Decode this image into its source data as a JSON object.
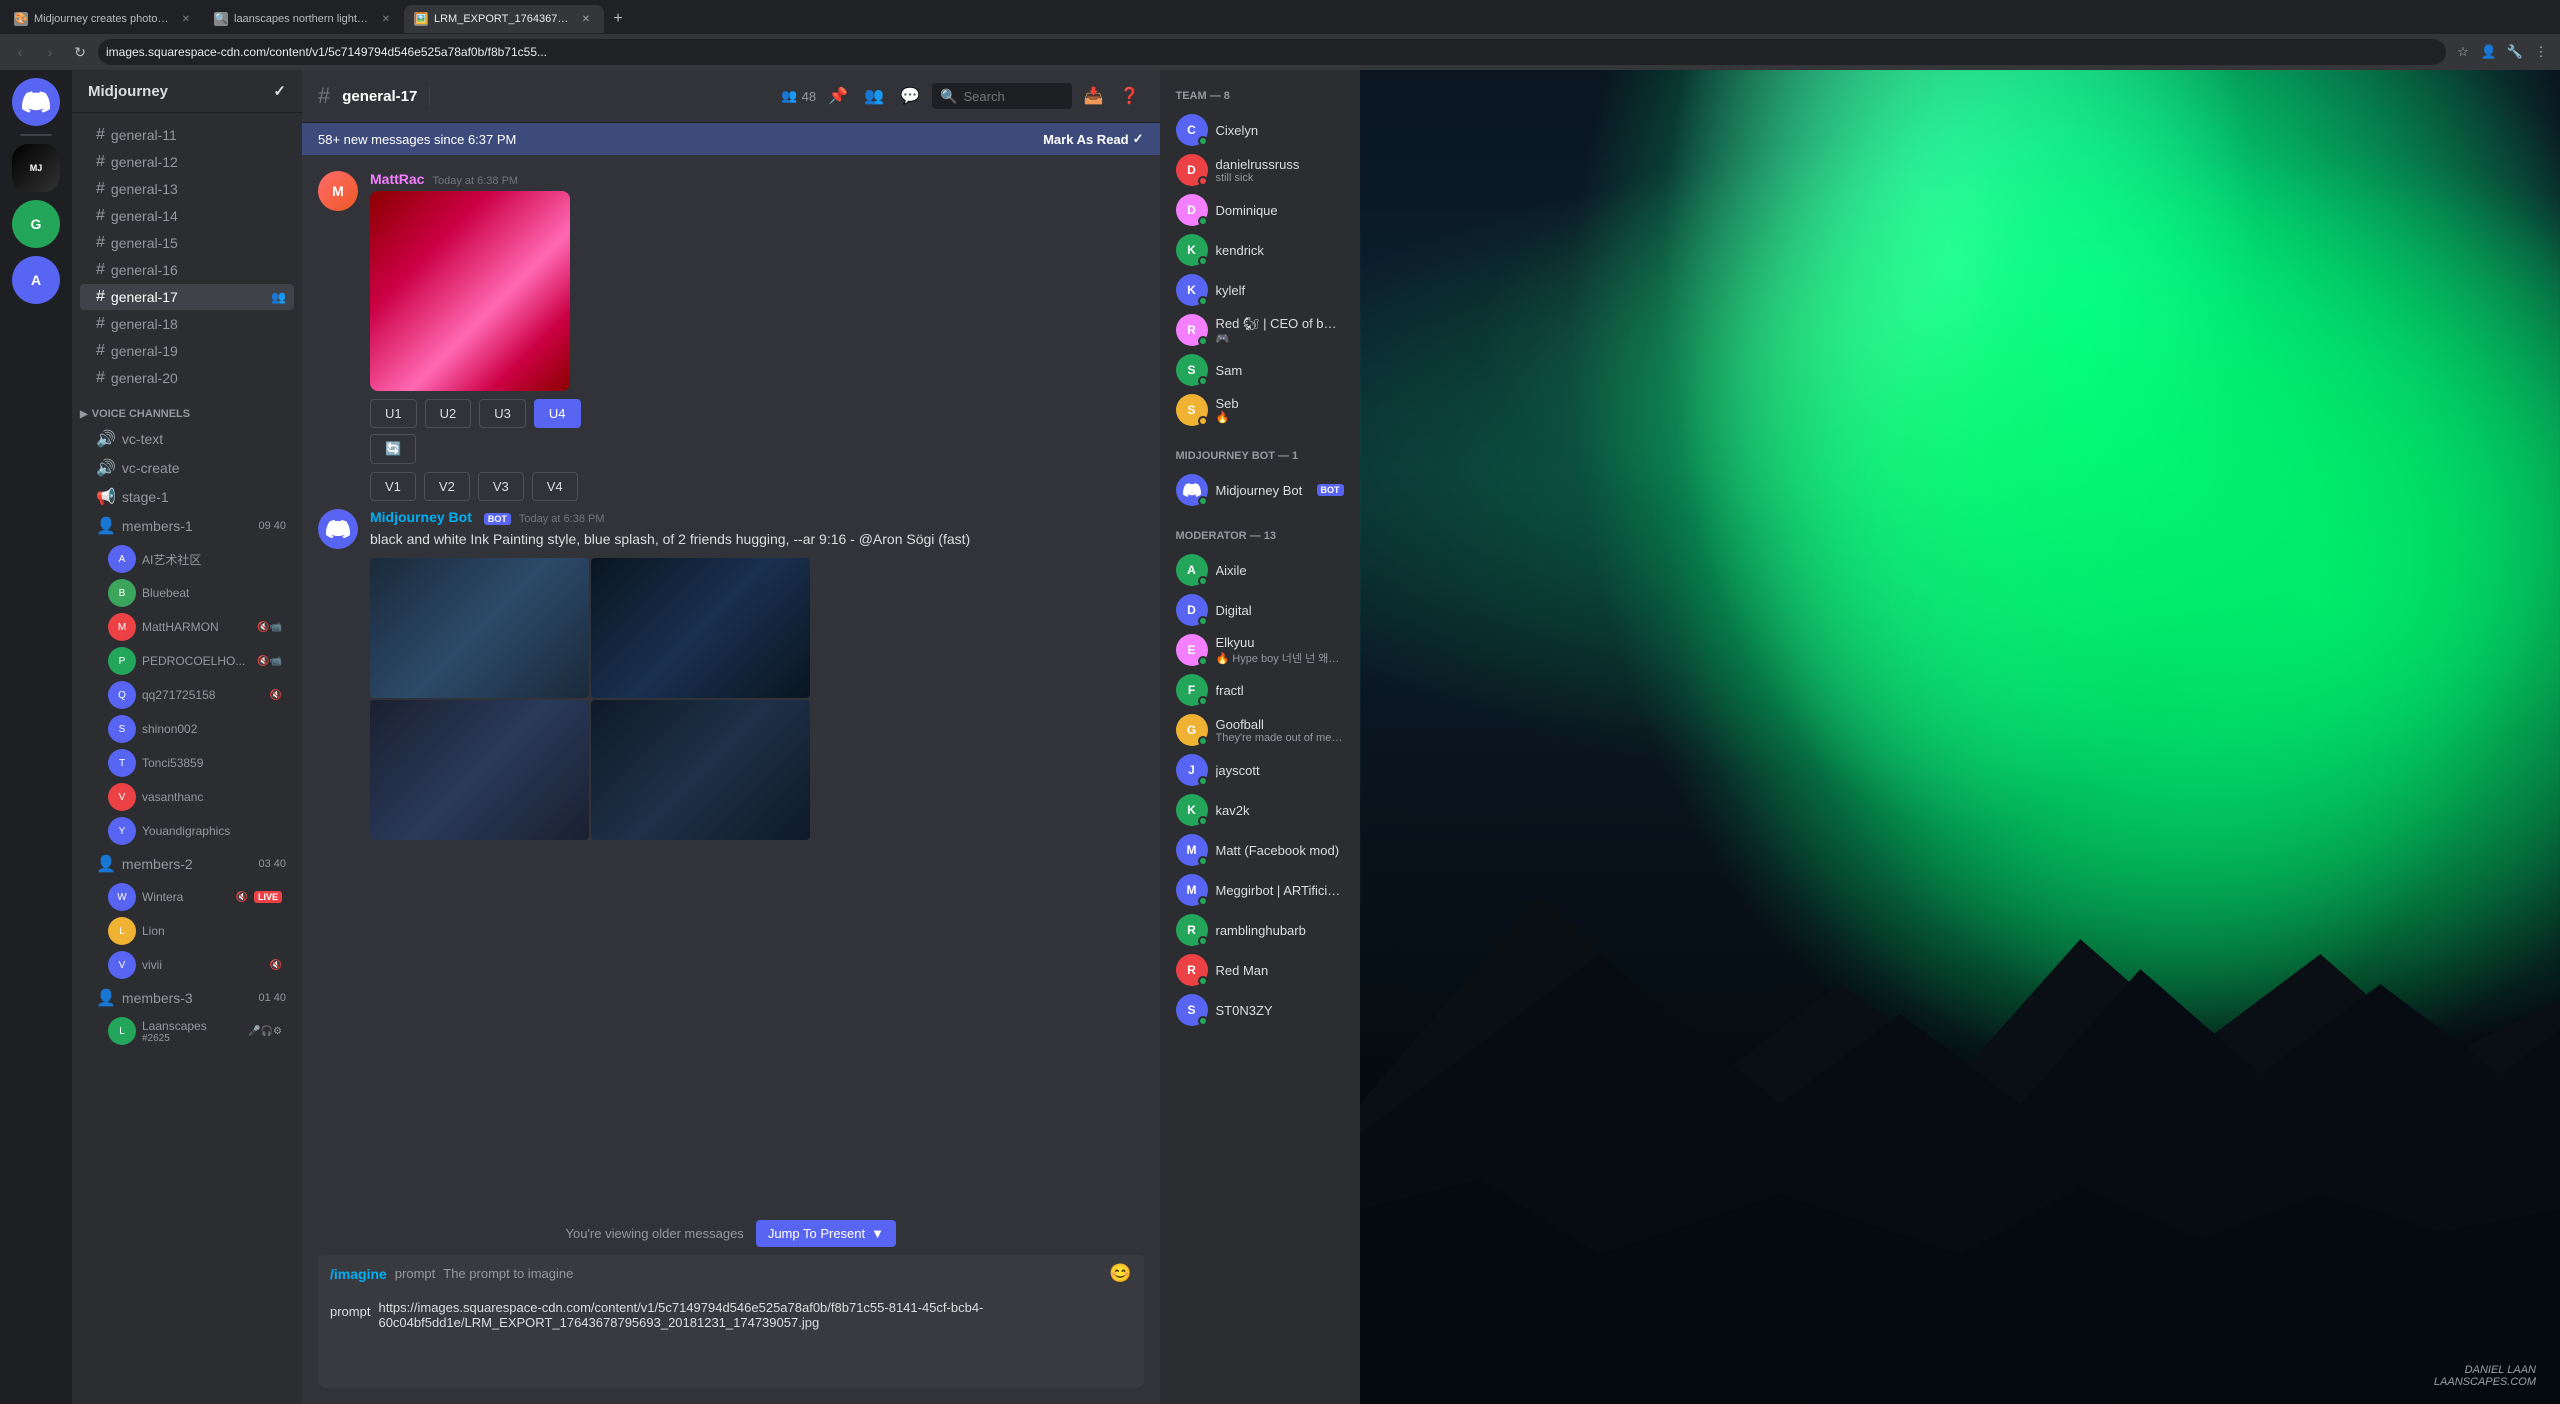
{
  "browser": {
    "tabs": [
      {
        "id": "tab1",
        "label": "Midjourney creates photorealis...",
        "active": false,
        "favicon": "🎨"
      },
      {
        "id": "tab2",
        "label": "laanscapes northern lights - Go...",
        "active": false,
        "favicon": "🔍"
      },
      {
        "id": "tab3",
        "label": "LRM_EXPORT_17643678795693...",
        "active": true,
        "favicon": "🖼️"
      }
    ],
    "url": "images.squarespace-cdn.com/content/v1/5c7149794d546e525a78af0b/f8b71c55...",
    "nav": {
      "back": "‹",
      "forward": "›",
      "refresh": "↻"
    }
  },
  "discord": {
    "window_title": "Discord",
    "server_name": "Midjourney",
    "channel_name": "general-17",
    "channel_stats": {
      "members": 48
    },
    "new_messages_bar": "58+ new messages since 6:37 PM",
    "mark_as_read": "Mark As Read",
    "search_placeholder": "Search",
    "channels": [
      {
        "name": "general-11",
        "type": "text"
      },
      {
        "name": "general-12",
        "type": "text"
      },
      {
        "name": "general-13",
        "type": "text"
      },
      {
        "name": "general-14",
        "type": "text"
      },
      {
        "name": "general-15",
        "type": "text"
      },
      {
        "name": "general-16",
        "type": "text"
      },
      {
        "name": "general-17",
        "type": "text",
        "active": true
      },
      {
        "name": "general-18",
        "type": "text"
      },
      {
        "name": "general-19",
        "type": "text"
      },
      {
        "name": "general-20",
        "type": "text"
      }
    ],
    "voice_channels": [
      {
        "name": "vc-text",
        "type": "voice"
      },
      {
        "name": "vc-create",
        "type": "voice"
      }
    ],
    "stage_channels": [
      {
        "name": "stage-1",
        "type": "stage"
      }
    ],
    "member_groups": [
      {
        "name": "members-1",
        "count1": "09",
        "count2": "40"
      },
      {
        "name": "members-2",
        "count1": "03",
        "count2": "40"
      },
      {
        "name": "members-3",
        "count1": "01",
        "count2": "40"
      }
    ],
    "online_members": [
      {
        "name": "AI艺术社区",
        "color": "#5865f2"
      },
      {
        "name": "Bluebeat",
        "color": "#5865f2"
      },
      {
        "name": "MattHARMON",
        "color": "#ed4245"
      },
      {
        "name": "PEDROCOELHO...",
        "color": "#23a55a"
      },
      {
        "name": "qq271725158",
        "color": "#5865f2"
      },
      {
        "name": "shinon002",
        "color": "#5865f2"
      },
      {
        "name": "Tonci53859",
        "color": "#5865f2"
      },
      {
        "name": "vasanthanc",
        "color": "#ed4245"
      },
      {
        "name": "Youandigraphics",
        "color": "#5865f2"
      },
      {
        "name": "Wintera",
        "color": "#5865f2",
        "badge": "LIVE"
      },
      {
        "name": "Lion",
        "color": "#f0b232"
      },
      {
        "name": "vivii",
        "color": "#5865f2"
      },
      {
        "name": "Laanscapes",
        "color": "#23a55a",
        "subtitle": "#2625"
      }
    ],
    "messages": [
      {
        "id": "msg1",
        "author": "MattRac",
        "author_color": "#f47fff",
        "time": "Today at 6:38 PM",
        "has_image": true,
        "image_type": "photo",
        "action_rows": [
          {
            "buttons": [
              "U1",
              "U2",
              "U3",
              "U4 (active)",
              "U4"
            ]
          },
          {
            "buttons": [
              "V1",
              "V2",
              "V3",
              "V4"
            ]
          }
        ]
      },
      {
        "id": "msg2",
        "author": "Midjourney Bot",
        "author_color": "#00b0f4",
        "is_bot": true,
        "time": "Today at 6:38 PM",
        "text": "black and white Ink Painting style, blue splash, of 2 friends hugging, --ar 9:16 - @Aron Sögi (fast)",
        "has_image": true,
        "image_type": "grid"
      }
    ],
    "viewing_older": "You're viewing older messages",
    "jump_to_present": "Jump To Present",
    "input": {
      "command": "/imagine",
      "prompt_label": "prompt",
      "prompt_placeholder": "The prompt to imagine",
      "prompt_value": "https://images.squarespace-cdn.com/content/v1/5c7149794d546e525a78af0b/f8b71c55-8141-45cf-bcb4-60c04bf5dd1e/LRM_EXPORT_17643678795693_20181231_174739057.jpg"
    },
    "members_sidebar": {
      "sections": [
        {
          "heading": "TEAM — 8",
          "members": [
            {
              "name": "Cixelyn",
              "color": "#5865f2"
            },
            {
              "name": "danielrussruss",
              "color": "#5865f2",
              "status": "still sick"
            },
            {
              "name": "Dominique",
              "color": "#ed4245"
            },
            {
              "name": "kendrick",
              "color": "#23a55a"
            },
            {
              "name": "kylelf",
              "color": "#5865f2"
            },
            {
              "name": "Red 🐿 | CEO of bugs ...",
              "color": "#f47fff",
              "subtitle": "🎮"
            },
            {
              "name": "Sam",
              "color": "#23a55a"
            },
            {
              "name": "Seb",
              "color": "#f0b232",
              "subtitle": "🔥"
            }
          ]
        },
        {
          "heading": "MIDJOURNEY BOT — 1",
          "members": [
            {
              "name": "Midjourney Bot",
              "color": "#5865f2",
              "is_bot": true
            }
          ]
        },
        {
          "heading": "MODERATOR — 13",
          "members": [
            {
              "name": "Aixile",
              "color": "#23a55a"
            },
            {
              "name": "Digital",
              "color": "#5865f2"
            },
            {
              "name": "Elkyuu",
              "color": "#f47fff",
              "status": "Hype boy 너넨 넌 왜해 Hype ..."
            },
            {
              "name": "fractl",
              "color": "#23a55a"
            },
            {
              "name": "Goofball",
              "color": "#f0b232",
              "status": "They're made out of meat."
            },
            {
              "name": "jayscott",
              "color": "#5865f2"
            },
            {
              "name": "kav2k",
              "color": "#23a55a"
            },
            {
              "name": "Matt (Facebook mod)",
              "color": "#5865f2"
            },
            {
              "name": "Meggirbot | ARTificial...",
              "color": "#5865f2"
            },
            {
              "name": "ramblinghubarb",
              "color": "#23a55a"
            },
            {
              "name": "Red Man",
              "color": "#ed4245"
            },
            {
              "name": "ST0N3ZY",
              "color": "#5865f2"
            }
          ]
        }
      ]
    }
  },
  "watermark": {
    "line1": "DANIEL LAAN",
    "line2": "LAANSCAPES.COM"
  }
}
